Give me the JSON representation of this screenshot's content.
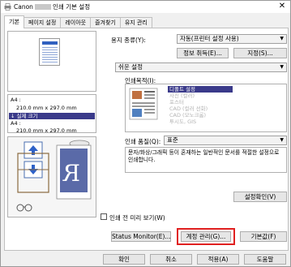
{
  "window": {
    "brand": "Canon",
    "title_suffix": "인쇄 기본 설정",
    "close_glyph": "✕"
  },
  "tabs": [
    {
      "label": "기본",
      "active": true
    },
    {
      "label": "페이지 설정",
      "active": false
    },
    {
      "label": "레이아웃",
      "active": false
    },
    {
      "label": "즐겨찾기",
      "active": false
    },
    {
      "label": "유지 관리",
      "active": false
    }
  ],
  "preview": {
    "info_lines": [
      "A4 :",
      "210.0 mm x 297.0 mm",
      "↓ 실제 크기",
      "A4 :",
      "210.0 mm x 297.0 mm"
    ],
    "media_icons": [
      "paper-up-arrow-icon",
      "paper-down-arrow-icon",
      "roll-paper-icon",
      "mirror-r-icon",
      "glasses-icon"
    ]
  },
  "media_type": {
    "label": "용지 종류(Y):",
    "value": "자동(프린터 설정 사용)"
  },
  "buttons": {
    "info": "정보 취득(E)...",
    "settings": "지정(S)...",
    "quality_settings": "설정확인(V)",
    "status_monitor": "Status Monitor(E)...",
    "account_mgmt": "계정 관리(G)...",
    "defaults": "기본값(F)",
    "ok": "확인",
    "cancel": "취소",
    "apply": "적용(A)",
    "help": "도움말"
  },
  "easy_setting": {
    "value": "쉬운 설정"
  },
  "purpose": {
    "label": "인쇄목적(I):",
    "options": [
      {
        "label": "디폴트 설정",
        "selected": true
      },
      {
        "label": "사진 (컬러)",
        "selected": false
      },
      {
        "label": "포스터",
        "selected": false
      },
      {
        "label": "CAD (컬러 선화)",
        "selected": false
      },
      {
        "label": "CAD (모노크롬)",
        "selected": false
      },
      {
        "label": "투시도, GIS",
        "selected": false
      }
    ]
  },
  "print_quality": {
    "label": "인쇄 품질(Q):",
    "value": "표준",
    "description": "문자/화상/그래픽 등이 혼재하는 일반적인 문서를 적절한 설정으로 인쇄합니다."
  },
  "preview_checkbox": {
    "label": "인쇄 전 미리 보기(W)",
    "checked": false
  },
  "colors": {
    "highlight": "#e02020",
    "selection": "#3a3a8a"
  }
}
